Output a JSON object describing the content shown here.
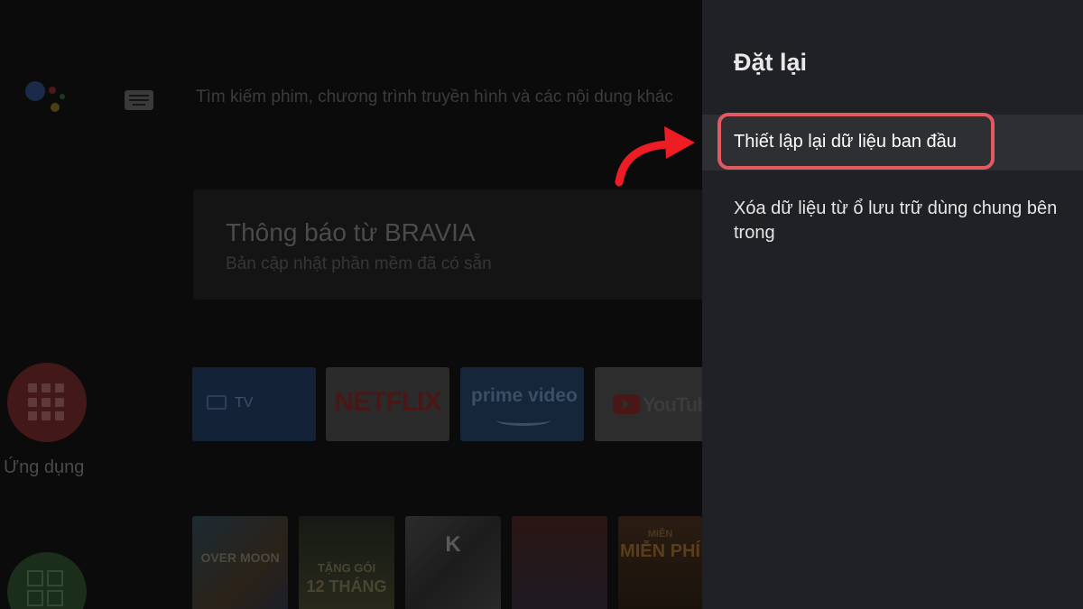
{
  "home": {
    "search_placeholder": "Tìm kiếm phim, chương trình truyền hình và các nội dung khác",
    "notification": {
      "title": "Thông báo từ BRAVIA",
      "subtitle": "Bản cập nhật phần mềm đã có sẵn"
    },
    "apps_label": "Ứng dụng",
    "app_tiles": [
      {
        "label": "TV"
      },
      {
        "label": "NETFLIX"
      },
      {
        "label": "prime video"
      },
      {
        "label": "YouTube"
      }
    ],
    "posters": [
      {
        "text": "OVER MOON"
      },
      {
        "text_top": "TẶNG GÓI",
        "text_bottom": "12 THÁNG"
      },
      {
        "text": "K"
      },
      {
        "text": ""
      },
      {
        "text_top": "MIỄN",
        "text_bottom": "MIỄN PHÍ"
      }
    ]
  },
  "panel": {
    "title": "Đặt lại",
    "items": [
      {
        "label": "Thiết lập lại dữ liệu ban đầu",
        "selected": true
      },
      {
        "label": "Xóa dữ liệu từ ổ lưu trữ dùng chung bên trong",
        "selected": false
      }
    ]
  },
  "colors": {
    "panel_bg": "#202124",
    "selected_bg": "#2e2f33",
    "highlight": "#e15a62",
    "arrow": "#ee1c25"
  }
}
